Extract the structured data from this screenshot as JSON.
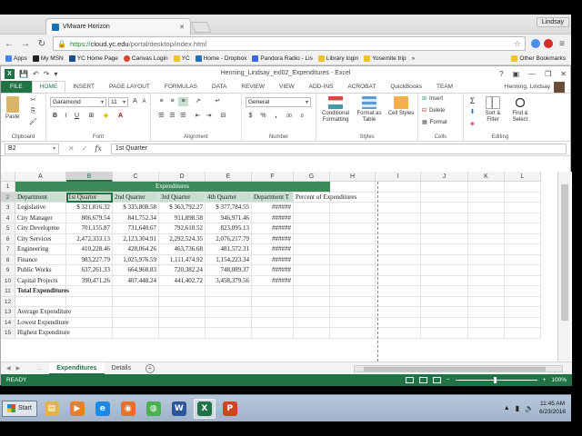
{
  "browser": {
    "tab_title": "VMware Horizon",
    "user_chip": "Lindsay",
    "url_scheme": "https://",
    "url_host": "cloud.yc.edu",
    "url_path": "/portal/desktop/index.html",
    "bookmarks": [
      {
        "label": "Apps",
        "color": "#4285f4"
      },
      {
        "label": "My MSN",
        "color": "#222222"
      },
      {
        "label": "YC Home Page",
        "color": "#1b4f8a"
      },
      {
        "label": "Canvas Login",
        "color": "#d64531"
      },
      {
        "label": "YC",
        "color": "#f2c12e"
      },
      {
        "label": "Home - Dropbox",
        "color": "#1e73be"
      },
      {
        "label": "Pandora Radio - Lis",
        "color": "#3668ff"
      },
      {
        "label": "Library login",
        "color": "#f2c12e"
      },
      {
        "label": "Yosemite trip",
        "color": "#f2c12e"
      }
    ],
    "bookmarks_overflow": "»",
    "other_bookmarks": "Other Bookmarks"
  },
  "excel": {
    "app_letter": "X",
    "doc_title": "Henning_Lindsay_exl02_Expenditures - Excel",
    "ribbon_tabs": [
      "FILE",
      "HOME",
      "INSERT",
      "PAGE LAYOUT",
      "FORMULAS",
      "DATA",
      "REVIEW",
      "VIEW",
      "ADD-INS",
      "ACROBAT",
      "QuickBooks",
      "TEAM"
    ],
    "user_name": "Henning, Lindsay",
    "ribbon": {
      "paste": "Paste",
      "clipboard": "Clipboard",
      "font_name": "Garamond",
      "font_size": "11",
      "font_group": "Font",
      "alignment_group": "Alignment",
      "number_format": "General",
      "number_group": "Number",
      "conditional_formatting": "Conditional Formatting",
      "format_as_table": "Format as Table",
      "cell_styles": "Cell Styles",
      "styles_group": "Styles",
      "insert": "Insert",
      "delete": "Delete",
      "format": "Format",
      "cells_group": "Cells",
      "sort_filter": "Sort & Filter",
      "find_select": "Find & Select",
      "editing_group": "Editing"
    },
    "name_box": "B2",
    "formula": "1st Quarter",
    "columns": [
      "A",
      "B",
      "C",
      "D",
      "E",
      "F",
      "G",
      "H",
      "I",
      "J",
      "K",
      "L"
    ],
    "rows": [
      "1",
      "2",
      "3",
      "4",
      "5",
      "6",
      "7",
      "8",
      "9",
      "10",
      "11",
      "12",
      "13",
      "14",
      "15"
    ],
    "sheet": {
      "banner": "Expenditures",
      "headers": [
        "Department",
        "1st Quarter",
        "2nd Quarter",
        "3rd Quarter",
        "4th Quarter",
        "Department T",
        "Percent of Expenditures"
      ],
      "data_rows": [
        {
          "dept": "Legislative",
          "q1": "$ 321,816.32",
          "q2": "$ 335,808.58",
          "q3": "$ 363,792.27",
          "q4": "$ 377,784.55",
          "total": "######"
        },
        {
          "dept": "City Manager",
          "q1": "806,679.54",
          "q2": "841,752.34",
          "q3": "911,898.58",
          "q4": "946,971.46",
          "total": "######"
        },
        {
          "dept": "City Developme",
          "q1": "701,155.87",
          "q2": "731,640.67",
          "q3": "792,610.52",
          "q4": "823,095.13",
          "total": "######"
        },
        {
          "dept": "City Services",
          "q1": "2,472,333.13",
          "q2": "2,123,304.91",
          "q3": "2,292,524.35",
          "q4": "2,076,217.79",
          "total": "######"
        },
        {
          "dept": "Engineering",
          "q1": "410,228.46",
          "q2": "428,064.26",
          "q3": "463,736.68",
          "q4": "481,572.31",
          "total": "######"
        },
        {
          "dept": "Finance",
          "q1": "983,227.79",
          "q2": "1,025,976.59",
          "q3": "1,111,474.92",
          "q4": "1,154,223.34",
          "total": "######"
        },
        {
          "dept": "Public Works",
          "q1": "637,261.33",
          "q2": "664,968.83",
          "q3": "720,382.24",
          "q4": "748,089.37",
          "total": "######"
        },
        {
          "dept": "Capital Projects",
          "q1": "390,471.26",
          "q2": "407,448.24",
          "q3": "441,402.72",
          "q4": "3,458,379.56",
          "total": "######"
        }
      ],
      "total_label": "Total Expenditures",
      "summary_labels": [
        "Average Expenditure",
        "Lowest Expenditure",
        "Highest Expenditure"
      ]
    },
    "sheet_tabs": [
      "Expenditures",
      "Details"
    ],
    "status": "READY",
    "zoom": "100%"
  },
  "taskbar": {
    "start": "Start",
    "apps": [
      {
        "name": "explorer",
        "glyph": "▤",
        "color": "#e0b44c"
      },
      {
        "name": "media-player",
        "glyph": "▶",
        "color": "#e5812d"
      },
      {
        "name": "internet-explorer",
        "glyph": "e",
        "color": "#1e88e5"
      },
      {
        "name": "firefox",
        "glyph": "◉",
        "color": "#e8712a"
      },
      {
        "name": "chrome",
        "glyph": "◍",
        "color": "#4caf50"
      },
      {
        "name": "word",
        "glyph": "W",
        "color": "#2b579a"
      },
      {
        "name": "excel",
        "glyph": "X",
        "color": "#217346"
      },
      {
        "name": "powerpoint",
        "glyph": "P",
        "color": "#d04423"
      }
    ],
    "time": "11:45 AM",
    "date": "6/23/2016"
  }
}
